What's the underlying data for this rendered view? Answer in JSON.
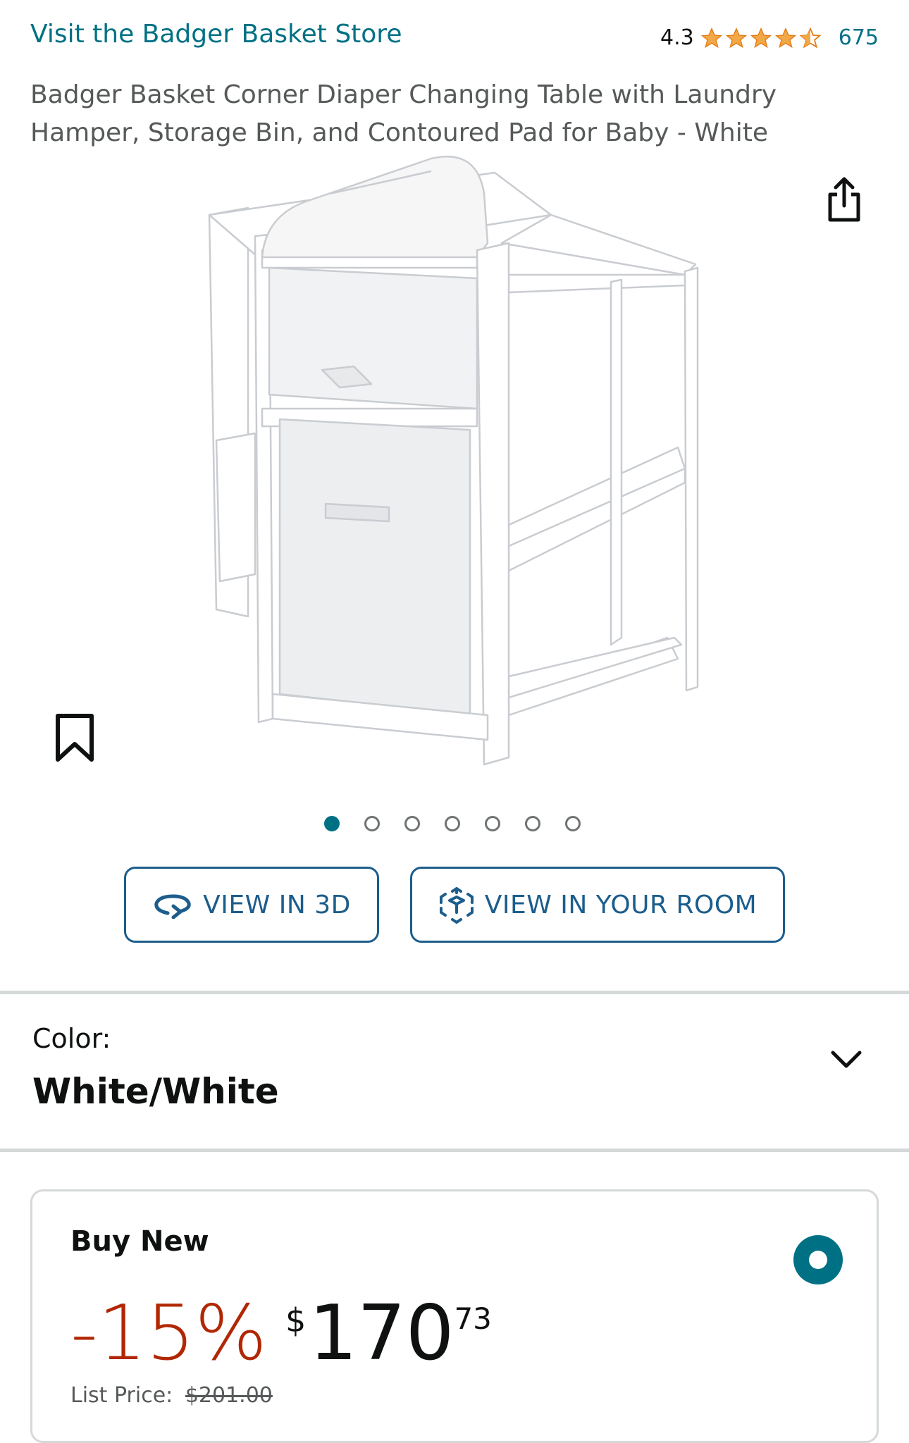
{
  "header": {
    "store_link": "Visit the Badger Basket Store",
    "rating_score": "4.3",
    "rating_value": 4.3,
    "rating_count": "675"
  },
  "product": {
    "title": "Badger Basket Corner Diaper Changing Table with Laundry Hamper, Storage Bin, and Contoured Pad for Baby - White"
  },
  "gallery": {
    "image_count": 7,
    "active_index": 0
  },
  "actions": {
    "view_3d_label": "VIEW IN 3D",
    "view_room_label": "VIEW IN YOUR ROOM"
  },
  "color": {
    "label": "Color:",
    "value": "White/White"
  },
  "buybox": {
    "title": "Buy New",
    "discount": "-15%",
    "currency": "$",
    "price_whole": "170",
    "price_fraction": "73",
    "list_price_label": "List Price:",
    "list_price_value": "$201.00"
  },
  "colors": {
    "link": "#007185",
    "star": "#f3a847",
    "discount": "#b12704",
    "button_border": "#1c5d8c"
  },
  "icons": {
    "share": "share-icon",
    "bookmark": "bookmark-icon",
    "rotate_3d": "rotate-3d-icon",
    "ar_cube": "ar-cube-icon",
    "chevron": "chevron-down-icon",
    "info": "info-icon"
  }
}
